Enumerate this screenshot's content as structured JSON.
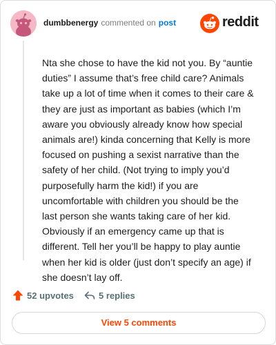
{
  "header": {
    "username": "dumbbenergy",
    "action_text": "commented on",
    "target_link": "post",
    "brand_name": "reddit"
  },
  "comment": {
    "body": "Nta she chose to have the kid not you. By “auntie duties” I assume that’s free child care? Animals take up a lot of time when it comes to their care & they are just as important as babies (which I’m aware you obviously already know how special animals are!) kinda concerning that Kelly is more focused on pushing a sexist narrative than the safety of her child. (Not trying to imply you’d purposefully harm the kid!) if you are uncomfortable with children you should be the last person she wants taking care of her kid. Obviously if an emergency came up that is different. Tell her you’ll be happy to play auntie when her kid is older (just don’t specify an age) if she doesn’t lay off."
  },
  "actions": {
    "upvotes_label": "52 upvotes",
    "replies_label": "5 replies"
  },
  "footer": {
    "view_comments_label": "View 5 comments"
  },
  "colors": {
    "brand_orange": "#ff4500",
    "link_blue": "#0079d3",
    "avatar_pink": "#f5b8c6",
    "muted_text": "#576f76"
  },
  "icons": {
    "upvote": "upvote-arrow-icon",
    "reply": "reply-arrow-icon",
    "brand": "reddit-snoo-icon",
    "avatar": "snoo-avatar-icon"
  }
}
